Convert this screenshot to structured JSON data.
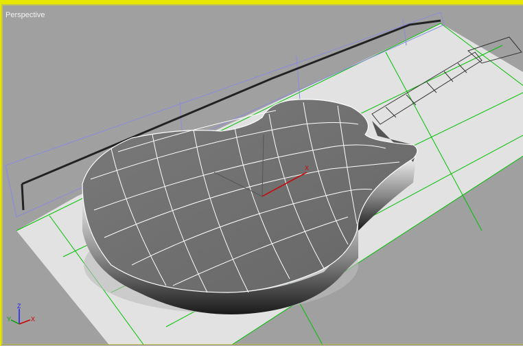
{
  "viewport": {
    "label": "Perspective",
    "active_border_color": "#e6e600",
    "background_color": "#a0a0a0"
  },
  "scene": {
    "object": "guitar-body-mesh",
    "ground_plane_color": "#e0e0e0",
    "grid_color": "#00c000",
    "wireframe_color": "#ffffff",
    "bounding_box_color": "#8a8adf"
  },
  "gizmo": {
    "x_label": "X",
    "color": "#d00000"
  },
  "axis_tripod": {
    "z_label": "Z",
    "x_label": "X",
    "y_label": "Y"
  }
}
